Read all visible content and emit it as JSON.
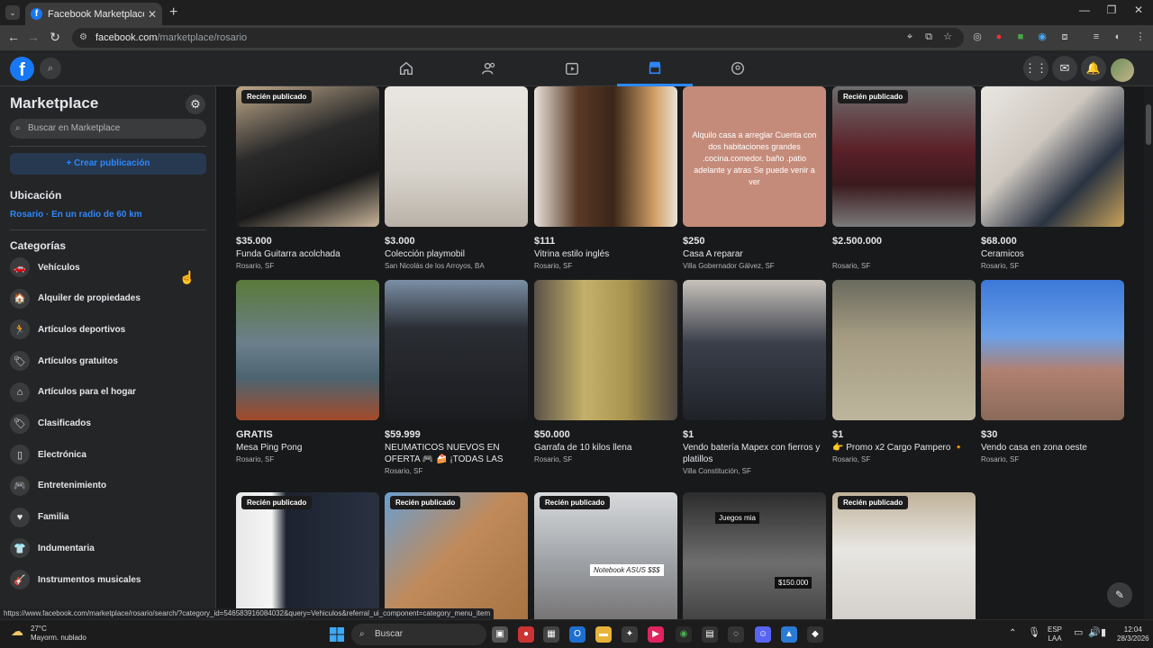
{
  "browser": {
    "tab_title": "Facebook Marketplace | Facebook",
    "tab_close": "✕",
    "new_tab": "+",
    "url_domain": "facebook.com",
    "url_path": "/marketplace/rosario"
  },
  "header": {
    "nav": [
      "home-icon",
      "friends-icon",
      "watch-icon",
      "marketplace-icon",
      "groups-icon"
    ],
    "active_nav": "marketplace-icon"
  },
  "sidebar": {
    "title": "Marketplace",
    "search_placeholder": "Buscar en Marketplace",
    "create_label": "+ Crear publicación",
    "location_heading": "Ubicación",
    "location_value": "Rosario · En un radio de 60 km",
    "categories_heading": "Categorías",
    "categories": [
      {
        "label": "Vehículos",
        "icon": "car-icon",
        "glyph": "🚗"
      },
      {
        "label": "Alquiler de propiedades",
        "icon": "house-key-icon",
        "glyph": "🏠"
      },
      {
        "label": "Artículos deportivos",
        "icon": "runner-icon",
        "glyph": "🏃"
      },
      {
        "label": "Artículos gratuitos",
        "icon": "tag-icon",
        "glyph": "🏷"
      },
      {
        "label": "Artículos para el hogar",
        "icon": "home-icon",
        "glyph": "⌂"
      },
      {
        "label": "Clasificados",
        "icon": "tag-icon",
        "glyph": "🏷"
      },
      {
        "label": "Electrónica",
        "icon": "phone-icon",
        "glyph": "▯"
      },
      {
        "label": "Entretenimiento",
        "icon": "gamepad-icon",
        "glyph": "🎮"
      },
      {
        "label": "Familia",
        "icon": "heart-icon",
        "glyph": "♥"
      },
      {
        "label": "Indumentaria",
        "icon": "shirt-icon",
        "glyph": "👕"
      },
      {
        "label": "Instrumentos musicales",
        "icon": "guitar-icon",
        "glyph": "🎸"
      }
    ]
  },
  "listings": [
    {
      "badge": "Recién publicado",
      "price": "$35.000",
      "title": "Funda Guitarra acolchada",
      "place": "Rosario, SF",
      "bg": "linear-gradient(160deg,#bfa88a 0%,#2a2a2a 40%,#1a1a1a 70%,#c9b59a 100%)"
    },
    {
      "badge": "",
      "price": "$3.000",
      "title": "Colección playmobil",
      "place": "San Nicolás de los Arroyos, BA",
      "bg": "linear-gradient(180deg,#e9e6e1 0%,#d9d4cd 60%,#b9b2a8 100%)"
    },
    {
      "badge": "",
      "price": "$111",
      "title": "Vitrina estilo inglés",
      "place": "Rosario, SF",
      "bg": "linear-gradient(90deg,#e8e2da 0%,#5a3a26 30%,#3a2518 55%,#d4a36a 85%,#e9e2d8 100%)"
    },
    {
      "badge": "",
      "price": "$250",
      "title": "Casa A reparar",
      "place": "Villa Gobernador Gálvez, SF",
      "bg": "#c58b7a",
      "overlay": "Alquilo casa a arreglar Cuenta con dos habitaciones grandes .cocina.comedor. baño .patio adelante y atras Se puede venir a ver"
    },
    {
      "badge": "Recién publicado",
      "price": "$2.500.000",
      "title": "",
      "place": "Rosario, SF",
      "bg": "linear-gradient(180deg,#6e6e6e 0%,#5b2028 45%,#3b1a1e 70%,#7a7a7a 100%)"
    },
    {
      "badge": "",
      "price": "$68.000",
      "title": "Ceramicos",
      "place": "Rosario, SF",
      "bg": "linear-gradient(135deg,#e9e6e2 0%,#cfc8c0 40%,#2a3342 70%,#c9a35a 100%)"
    },
    {
      "badge": "",
      "price": "GRATIS",
      "title": "Mesa Ping Pong",
      "place": "Rosario, SF",
      "bg": "linear-gradient(180deg,#5a7a3a 0%,#6b7f8c 45%,#4c6470 70%,#a24a2a 100%)"
    },
    {
      "badge": "",
      "price": "$59.999",
      "title": "NEUMATICOS NUEVOS EN OFERTA 🎮 🍰 ¡TODAS LAS MEDIDAS...",
      "place": "Rosario, SF",
      "bg": "linear-gradient(180deg,#7b8fa5 0%,#2a2d33 35%,#1b1c20 100%)"
    },
    {
      "badge": "",
      "price": "$50.000",
      "title": "Garrafa de 10 kilos llena",
      "place": "Rosario, SF",
      "bg": "linear-gradient(90deg,#5a5248 0%,#c4b06a 35%,#a8944e 65%,#4e4740 100%)"
    },
    {
      "badge": "",
      "price": "$1",
      "title": "Vendo batería Mapex con fierros y platillos",
      "place": "Villa Constitución, SF",
      "bg": "linear-gradient(180deg,#c8c2bb 0%,#3a3f4a 45%,#1f2228 100%)"
    },
    {
      "badge": "",
      "price": "$1",
      "title": "👉 Promo x2 Cargo Pampero 🔸",
      "place": "Rosario, SF",
      "bg": "linear-gradient(180deg,#6a6a5e 0%,#a49b82 40%,#bdb59c 100%)"
    },
    {
      "badge": "",
      "price": "$30",
      "title": "Vendo casa en zona oeste",
      "place": "Rosario, SF",
      "bg": "linear-gradient(180deg,#3c78d8 0%,#6aa0e8 40%,#b08070 65%,#8a6a5a 100%)"
    },
    {
      "badge": "Recién publicado",
      "price": "",
      "title": "",
      "place": "",
      "bg": "linear-gradient(90deg,#e8e8e8 0%,#f5f5f5 25%,#1c2230 35%,#2a3140 100%)"
    },
    {
      "badge": "Recién publicado",
      "price": "",
      "title": "",
      "place": "",
      "bg": "linear-gradient(135deg,#6a9ed0 0%,#c08a5a 45%,#a4713f 100%)"
    },
    {
      "badge": "Recién publicado",
      "price": "",
      "title": "",
      "place": "",
      "bg": "linear-gradient(180deg,#d8dadc 0%,#9ea2a6 50%,#6e6a6a 100%)",
      "overlay2": "Notebook ASUS $$$"
    },
    {
      "badge": "",
      "price": "",
      "title": "",
      "place": "",
      "bg": "linear-gradient(180deg,#2c2c2c 0%,#6e6e6e 50%,#3a3a3a 100%)",
      "tag": "Juegos mia",
      "tag2": "$150.000"
    },
    {
      "badge": "Recién publicado",
      "price": "",
      "title": "",
      "place": "",
      "bg": "linear-gradient(180deg,#c0b29a 0%,#e8e6e2 40%,#d0ccc6 100%)"
    }
  ],
  "status_url": "https://www.facebook.com/marketplace/rosario/search/?category_id=546583916084032&query=Vehiculos&referral_ui_component=category_menu_item",
  "taskbar": {
    "weather_temp": "27°C",
    "weather_desc": "Mayorm. nublado",
    "search_label": "Buscar",
    "lang1": "ESP",
    "lang2": "LAA",
    "time": "12:04",
    "date": "28/3/2026"
  }
}
